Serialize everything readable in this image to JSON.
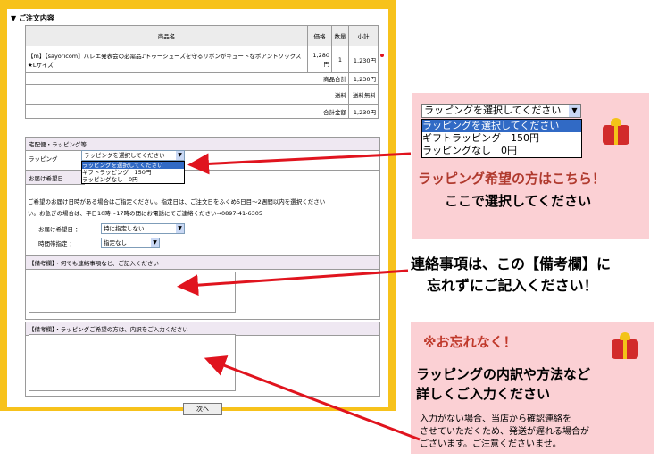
{
  "form": {
    "section_title": "▼ ご注文内容",
    "table_headers": [
      "商品名",
      "価格",
      "数量",
      "小計"
    ],
    "item": {
      "name": "【m】【sayoricom】バレエ発表会の必需品♪トゥーシューズを守るリボンがキュートなポアントソックス★Lサイズ",
      "price": "1,280円",
      "qty": "1",
      "subtotal": "1,230円"
    },
    "subtotal_label": "商品合計",
    "subtotal_value": "1,230円",
    "shipping_label": "送料",
    "shipping_value": "送料無料",
    "total_label": "合計金額",
    "total_value": "1,230円",
    "delivery_header": "宅配便・ラッピング等",
    "wrapping_label": "ラッピング",
    "wrapping_selected": "ラッピングを選択してください",
    "wrapping_options": [
      "ラッピングを選択してください",
      "ギフトラッピング　150円",
      "ラッピングなし　0円"
    ],
    "delivery_date_header": "お届け希望日",
    "delivery_note_1": "ご希望のお届け日時がある場合はご指定ください。指定日は、ご注文日をふくめ5日目〜2週間以内を選択ください。お急ぎの場合は、平日10時〜17時の間にお電話にてご連絡ください⇒0897-41-6305",
    "delivery_note_1a": "ご希望のお届け日時がある場合はご指定ください。指定日は、ご注文日をふくめ5日目〜2週間以内を選択ください",
    "delivery_note_1b": "い。お急ぎの場合は、平日10時〜17時の間にお電話にてご連絡ください⇒0897-41-6305",
    "date_label": "お届け希望日 ：",
    "date_value": "特に指定しない",
    "time_label": "時間帯指定 ：",
    "time_value": "指定なし",
    "remarks_header": "【備考欄】・何でも連絡事項など、ご記入ください",
    "wrap_remarks_header": "【備考欄】・ラッピングご希望の方は、内訳をご入力ください",
    "next_button": "次へ"
  },
  "callouts": {
    "popup_selected": "ラッピングを選択してください",
    "popup_options": [
      "ラッピングを選択してください",
      "ギフトラッピング　150円",
      "ラッピングなし　0円"
    ],
    "wrap_line1": "ラッピング希望の方はこちら！",
    "wrap_line2": "ここで選択してください",
    "remarks_line1": "連絡事項は、この【備考欄】に",
    "remarks_line2": "忘れずにご記入ください！",
    "reminder_title": "※お忘れなく！",
    "reminder_line1": "ラッピングの内訳や方法など",
    "reminder_line2": "詳しくご入力ください",
    "reminder_note1": "入力がない場合、当店から確認連絡を",
    "reminder_note2": "させていただくため、発送が遅れる場合が",
    "reminder_note3": "ございます。ご注意くださいませ。"
  },
  "colors": {
    "frame": "#f7c21b",
    "callout_bg": "#fbd0d4",
    "callout_text": "#c0392b",
    "arrow": "#e0141e"
  }
}
